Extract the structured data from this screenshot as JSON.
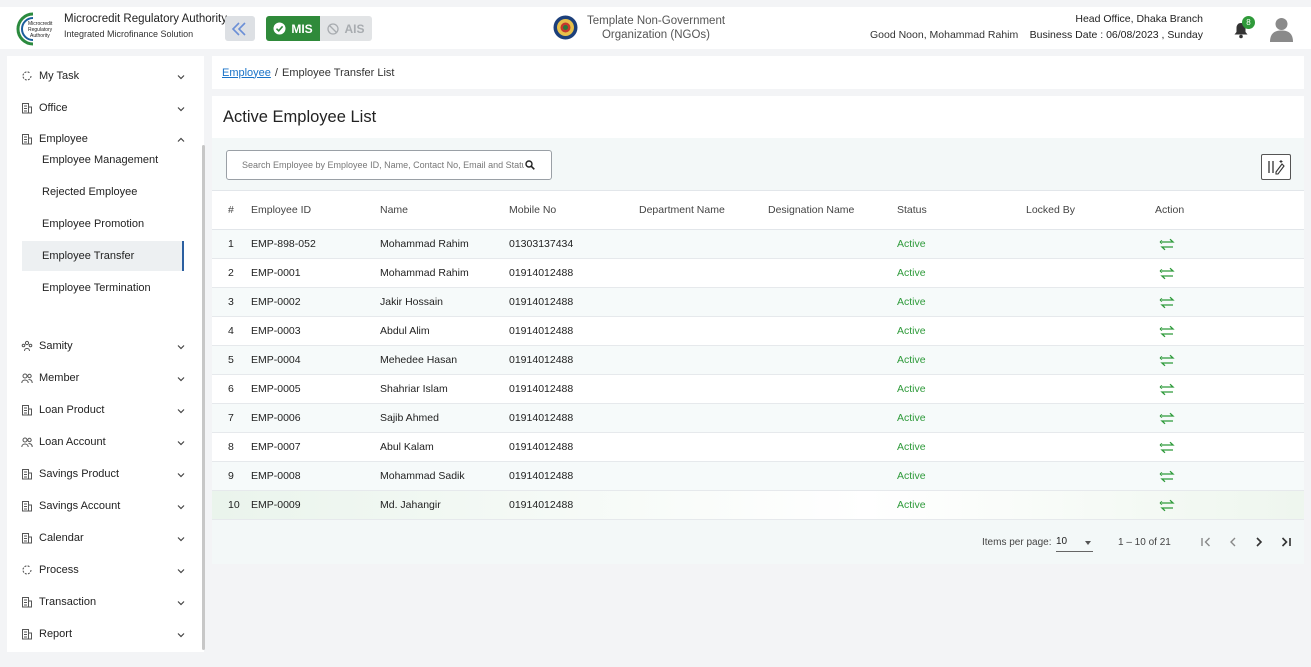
{
  "header": {
    "brand_title": "Microcredit Regulatory Authority",
    "brand_subtitle": "Integrated Microfinance Solution",
    "logo_text": [
      "Microcredit",
      "Regulatory",
      "Authority"
    ],
    "mis_label": "MIS",
    "ais_label": "AIS",
    "org_line1": "Template Non-Government",
    "org_line2": "Organization (NGOs)",
    "greeting": "Good Noon, Mohammad Rahim",
    "branch": "Head Office, Dhaka Branch",
    "business_date": "Business Date : 06/08/2023 , Sunday",
    "notification_count": "8"
  },
  "sidebar": {
    "items": [
      {
        "label": "My Task",
        "icon": "refresh-icon",
        "expanded": false
      },
      {
        "label": "Office",
        "icon": "building-icon",
        "expanded": false
      },
      {
        "label": "Employee",
        "icon": "building-icon",
        "expanded": true
      },
      {
        "label": "Samity",
        "icon": "group-icon",
        "expanded": false
      },
      {
        "label": "Member",
        "icon": "users-icon",
        "expanded": false
      },
      {
        "label": "Loan Product",
        "icon": "building-icon",
        "expanded": false
      },
      {
        "label": "Loan Account",
        "icon": "users-icon",
        "expanded": false
      },
      {
        "label": "Savings Product",
        "icon": "building-icon",
        "expanded": false
      },
      {
        "label": "Savings Account",
        "icon": "building-icon",
        "expanded": false
      },
      {
        "label": "Calendar",
        "icon": "building-icon",
        "expanded": false
      },
      {
        "label": "Process",
        "icon": "refresh-icon",
        "expanded": false
      },
      {
        "label": "Transaction",
        "icon": "building-icon",
        "expanded": false
      },
      {
        "label": "Report",
        "icon": "building-icon",
        "expanded": false
      }
    ],
    "employee_sub": [
      "Employee Management",
      "Rejected Employee",
      "Employee Promotion",
      "Employee Transfer",
      "Employee Termination"
    ]
  },
  "breadcrumb": {
    "parent": "Employee",
    "separator": "/",
    "current": "Employee Transfer List"
  },
  "main": {
    "title": "Active Employee List",
    "search_placeholder": "Search Employee by Employee ID, Name, Contact No, Email and Status",
    "columns": [
      "#",
      "Employee ID",
      "Name",
      "Mobile No",
      "Department Name",
      "Designation Name",
      "Status",
      "Locked By",
      "Action"
    ],
    "rows": [
      {
        "idx": "1",
        "id": "EMP-898-052",
        "name": "Mohammad Rahim",
        "mobile": "01303137434",
        "dept": "",
        "desig": "",
        "status": "Active",
        "locked": ""
      },
      {
        "idx": "2",
        "id": "EMP-0001",
        "name": "Mohammad Rahim",
        "mobile": "01914012488",
        "dept": "",
        "desig": "",
        "status": "Active",
        "locked": ""
      },
      {
        "idx": "3",
        "id": "EMP-0002",
        "name": "Jakir Hossain",
        "mobile": "01914012488",
        "dept": "",
        "desig": "",
        "status": "Active",
        "locked": ""
      },
      {
        "idx": "4",
        "id": "EMP-0003",
        "name": "Abdul Alim",
        "mobile": "01914012488",
        "dept": "",
        "desig": "",
        "status": "Active",
        "locked": ""
      },
      {
        "idx": "5",
        "id": "EMP-0004",
        "name": "Mehedee Hasan",
        "mobile": "01914012488",
        "dept": "",
        "desig": "",
        "status": "Active",
        "locked": ""
      },
      {
        "idx": "6",
        "id": "EMP-0005",
        "name": "Shahriar Islam",
        "mobile": "01914012488",
        "dept": "",
        "desig": "",
        "status": "Active",
        "locked": ""
      },
      {
        "idx": "7",
        "id": "EMP-0006",
        "name": "Sajib Ahmed",
        "mobile": "01914012488",
        "dept": "",
        "desig": "",
        "status": "Active",
        "locked": ""
      },
      {
        "idx": "8",
        "id": "EMP-0007",
        "name": "Abul Kalam",
        "mobile": "01914012488",
        "dept": "",
        "desig": "",
        "status": "Active",
        "locked": ""
      },
      {
        "idx": "9",
        "id": "EMP-0008",
        "name": "Mohammad Sadik",
        "mobile": "01914012488",
        "dept": "",
        "desig": "",
        "status": "Active",
        "locked": ""
      },
      {
        "idx": "10",
        "id": "EMP-0009",
        "name": "Md. Jahangir",
        "mobile": "01914012488",
        "dept": "",
        "desig": "",
        "status": "Active",
        "locked": ""
      }
    ],
    "paginator": {
      "items_per_page_label": "Items per page:",
      "page_size": "10",
      "range": "1 – 10 of 21"
    }
  },
  "colors": {
    "accent_green": "#2f8a3a",
    "status_active": "#2e9a3a",
    "link_blue": "#1a73c8",
    "active_indicator": "#2b5fa0"
  }
}
